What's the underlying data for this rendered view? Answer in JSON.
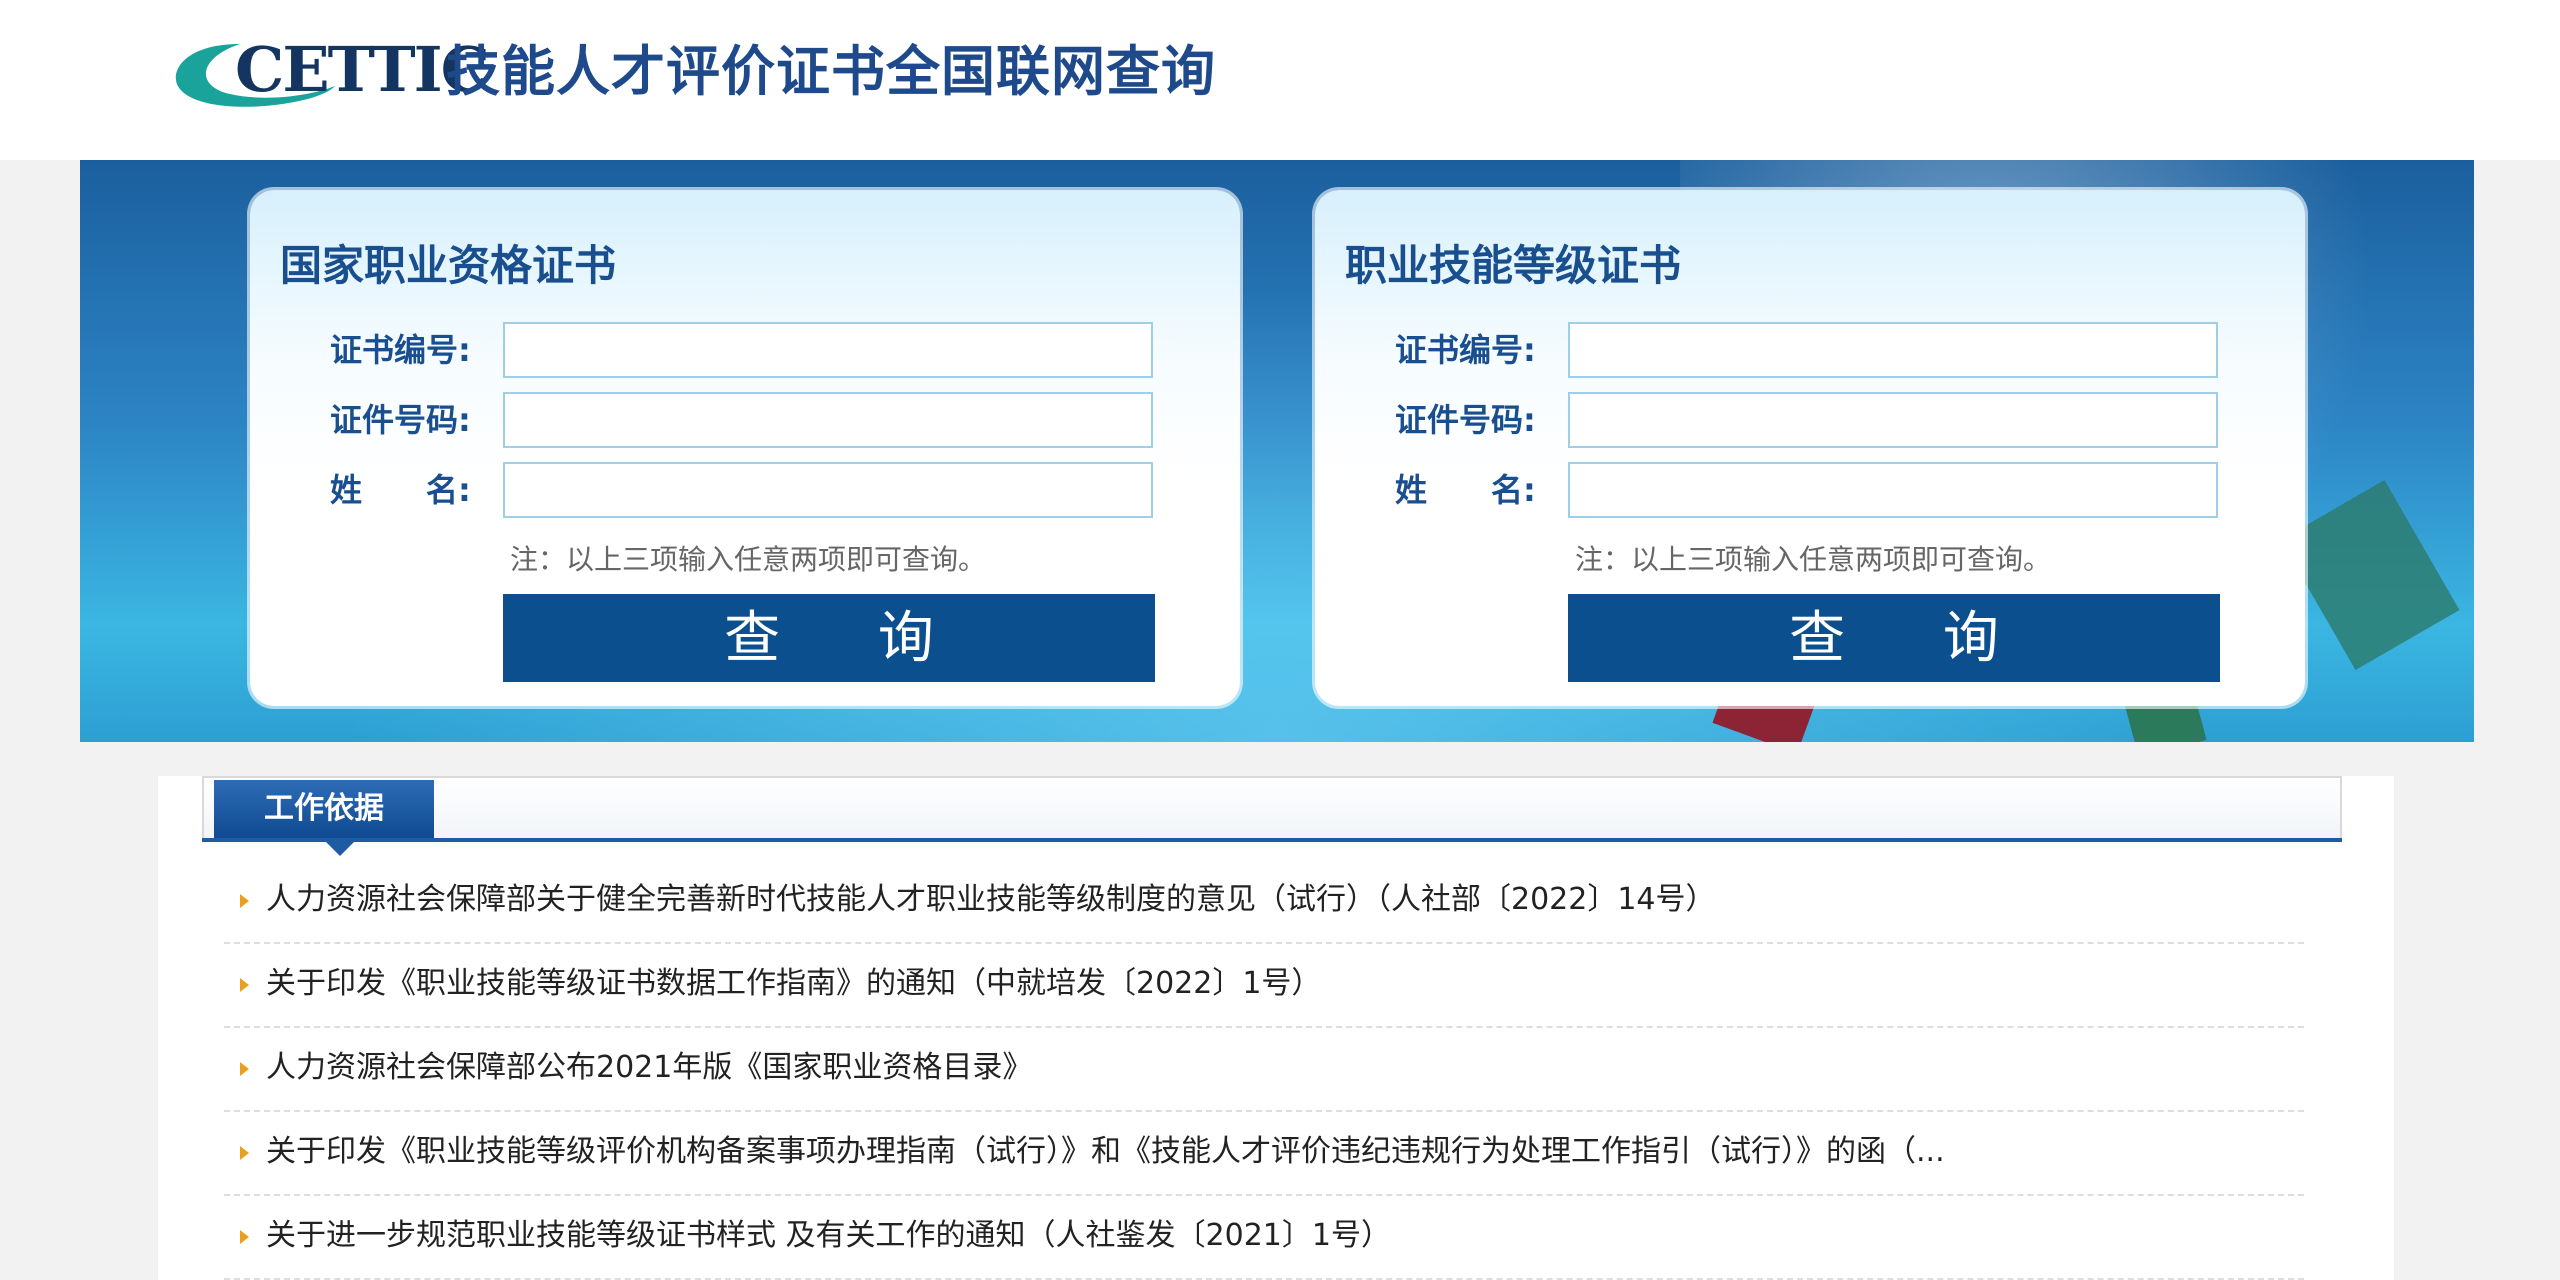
{
  "header": {
    "logo_text": "CETTIC",
    "logo_icon": "cettic-swoosh-logo",
    "site_title": "技能人才评价证书全国联网查询"
  },
  "colors": {
    "brand_blue": "#1e4a8c",
    "button_blue": "#0b4f8e",
    "logo_teal": "#1aa39a",
    "bullet_orange": "#e8a020"
  },
  "left_form": {
    "title": "国家职业资格证书",
    "fields": [
      {
        "label": "证书编号:",
        "value": ""
      },
      {
        "label": "证件号码:",
        "value": ""
      },
      {
        "label": "姓　　名:",
        "value": ""
      }
    ],
    "note": "注：以上三项输入任意两项即可查询。",
    "button": "查 询"
  },
  "right_form": {
    "title": "职业技能等级证书",
    "fields": [
      {
        "label": "证书编号:",
        "value": ""
      },
      {
        "label": "证件号码:",
        "value": ""
      },
      {
        "label": "姓　　名:",
        "value": ""
      }
    ],
    "note": "注：以上三项输入任意两项即可查询。",
    "button": "查 询"
  },
  "content": {
    "tab_label": "工作依据",
    "items": [
      "人力资源社会保障部关于健全完善新时代技能人才职业技能等级制度的意见（试行）（人社部〔2022〕14号）",
      "关于印发《职业技能等级证书数据工作指南》的通知（中就培发〔2022〕1号）",
      "人力资源社会保障部公布2021年版《国家职业资格目录》",
      "关于印发《职业技能等级评价机构备案事项办理指南（试行）》和《技能人才评价违纪违规行为处理工作指引（试行）》的函（...",
      "关于进一步规范职业技能等级证书样式 及有关工作的通知（人社鉴发〔2021〕1号）"
    ]
  }
}
